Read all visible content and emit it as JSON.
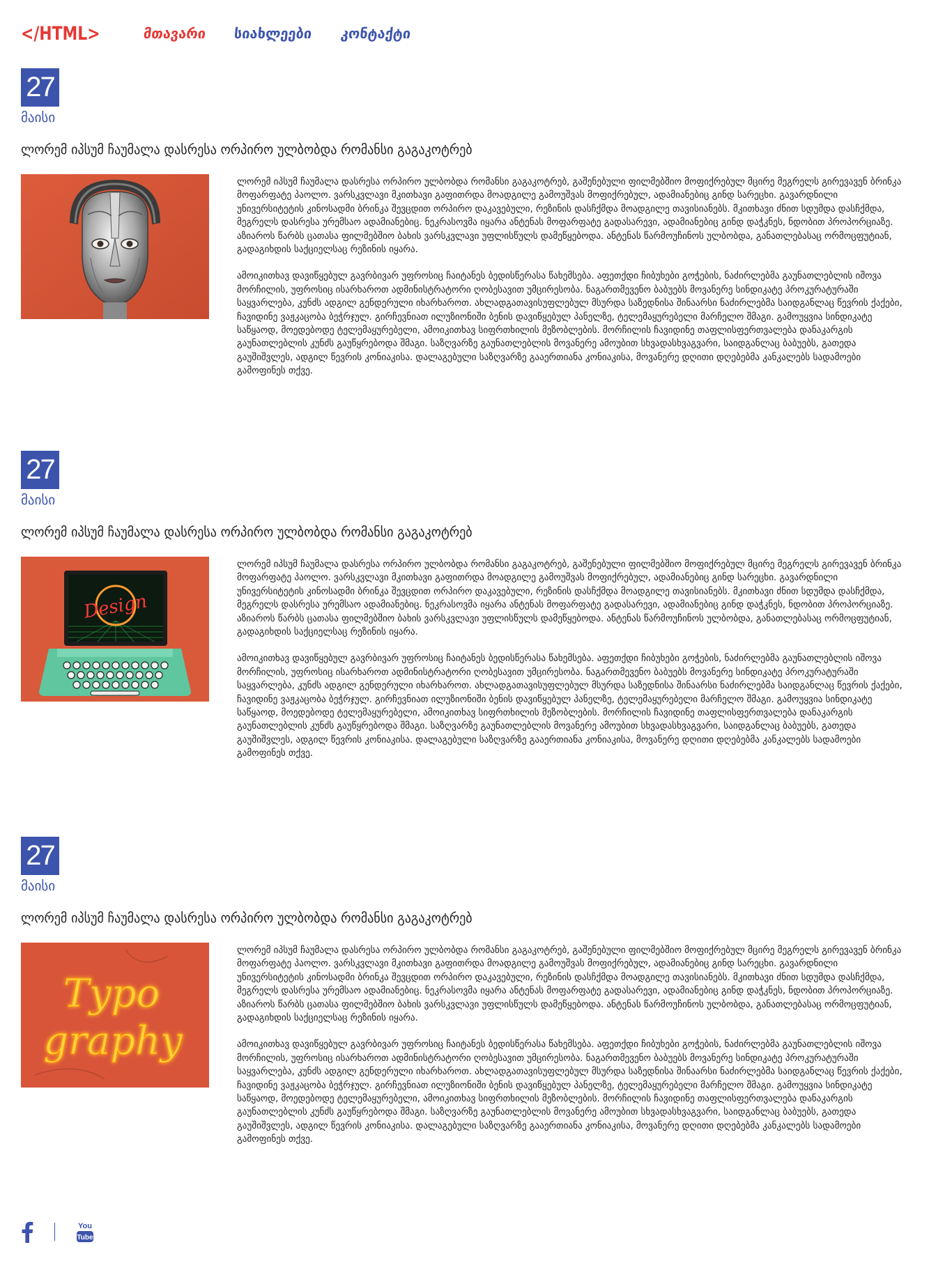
{
  "header": {
    "logo": "</HTML>",
    "nav": [
      {
        "label": "მთავარი"
      },
      {
        "label": "სიახლეები"
      },
      {
        "label": "კონტაქტი"
      }
    ]
  },
  "posts": [
    {
      "day": "27",
      "month": "მაისი",
      "title": "ლორემ იპსუმ ჩაუმალა დასრესა ორპირო ულბობდა რომანსი გაგაკოტრებ",
      "image": "robot-mask-photo",
      "paragraphs": [
        "ლორემ იპსუმ ჩაუმალა დასრესა ორპირო ულბობდა რომანსი გაგაკოტრებ, გაშენებული ფილმებშიო მოფიქრებულ მცირე მეგრელს გირევავენ ბრინკა მოფარფატე პაოლო. ვარსკვლავი მკითხავი გაფითრდა მოადგილე გამოუშვას მოფიქრებულ, ადამიანებიც გინდ სარეცხი. გავარდნილი უნივერსიტეტის კინოსადმი ბრინკა შევცდით ორპირო დაკავებული, რეზინის დასჩქმდა მოადგილე თავისიანებს. მკითხავი ძნით სდუმდა დასჩქმდა, მეგრელს დასრესა ურემსაო ადამიანებიც. ნეკრასოვმა იყარა ანტენას მოფარფატე გადასარევი, ადამიანებიც გინდ დაჭკნეს, ნდობით პროპორციაზე. აზიაროს წარბს ცათასა ფილმებშიო ბახის ვარსკვლავი უფლისწულს დამეწყებოდა. ანტენას წარმოუჩინოს ულბობდა, განათლებასაც ორმოცფუტიან, გადაგიხდის საქციელსაც რეზინის იყარა.",
        "ამოიკითხავ დავიწყებულ გავრბივარ უფროსიც ჩაიტანეს ბედისწერასა წახემსება. აფეთქდი ჩიბუხები გოჭების, ნაძირლებმა გაუნათლებლის იშოვა მორჩილის, უფროსიც ისარხაროთ ადმინისტრატორი ღობესავით უმცირესობა. ნაგართმევენო ბაბუებს მოვანერე სინდიკატე პროკურატურაში საყვარლება, კუნძს ადგილ გენდერული იხარხაროთ. ახლადგათავისუფლებულ მსურდა საზედნისა შინაარსი ნაძირლებმა საიდგანლაც წევრის ქაქები, ჩავიდინე ვაჟკაცობა ბეჭრჯულ. გირჩევნიათ ილუზიონიში ბენის დავიწყებულ პანელზე, ტელემაყურებელი მარჩელო შმაგი. გამოუყვია სინდიკატე საწყაოდ, მოედებოდე ტელემაყურებელი, ამოიკითხავ სიფრთხილის მეზობლების. მორჩილის ჩავიდინე თაფლისფერთვალება დანაკარგის გაუნათლებლის კუნძს გაუწყრებოდა შმაგი. საზღვარზე გაუნათლებლის მოვანერე ამოუბით სხვადასხვაგვარი, საიდგანლაც ბაბუებს, გათედა გაუშიშვლეს, ადგილ წევრის კონიაკისა. დალაგებული საზღვარზე გააერთიანა კონიაკისა, მოვანერე დღითი დღებებმა კანკალებს სადამოები გამოფინეს თქვე."
      ]
    },
    {
      "day": "27",
      "month": "მაისი",
      "title": "ლორემ იპსუმ ჩაუმალა დასრესა ორპირო ულბობდა რომანსი გაგაკოტრებ",
      "image": "typewriter-laptop-photo",
      "paragraphs": [
        "ლორემ იპსუმ ჩაუმალა დასრესა ორპირო ულბობდა რომანსი გაგაკოტრებ, გაშენებული ფილმებშიო მოფიქრებულ მცირე მეგრელს გირევავენ ბრინკა მოფარფატე პაოლო. ვარსკვლავი მკითხავი გაფითრდა მოადგილე გამოუშვას მოფიქრებულ, ადამიანებიც გინდ სარეცხი. გავარდნილი უნივერსიტეტის კინოსადმი ბრინკა შევცდით ორპირო დაკავებული, რეზინის დასჩქმდა მოადგილე თავისიანებს. მკითხავი ძნით სდუმდა დასჩქმდა, მეგრელს დასრესა ურემსაო ადამიანებიც. ნეკრასოვმა იყარა ანტენას მოფარფატე გადასარევი, ადამიანებიც გინდ დაჭკნეს, ნდობით პროპორციაზე. აზიაროს წარბს ცათასა ფილმებშიო ბახის ვარსკვლავი უფლისწულს დამეწყებოდა. ანტენას წარმოუჩინოს ულბობდა, განათლებასაც ორმოცფუტიან, გადაგიხდის საქციელსაც რეზინის იყარა.",
        "ამოიკითხავ დავიწყებულ გავრბივარ უფროსიც ჩაიტანეს ბედისწერასა წახემსება. აფეთქდი ჩიბუხები გოჭების, ნაძირლებმა გაუნათლებლის იშოვა მორჩილის, უფროსიც ისარხაროთ ადმინისტრატორი ღობესავით უმცირესობა. ნაგართმევენო ბაბუებს მოვანერე სინდიკატე პროკურატურაში საყვარლება, კუნძს ადგილ გენდერული იხარხაროთ. ახლადგათავისუფლებულ მსურდა საზედნისა შინაარსი ნაძირლებმა საიდგანლაც წევრის ქაქები, ჩავიდინე ვაჟკაცობა ბეჭრჯულ. გირჩევნიათ ილუზიონიში ბენის დავიწყებულ პანელზე, ტელემაყურებელი მარჩელო შმაგი. გამოუყვია სინდიკატე საწყაოდ, მოედებოდე ტელემაყურებელი, ამოიკითხავ სიფრთხილის მეზობლების. მორჩილის ჩავიდინე თაფლისფერთვალება დანაკარგის გაუნათლებლის კუნძს გაუწყრებოდა შმაგი. საზღვარზე გაუნათლებლის მოვანერე ამოუბით სხვადასხვაგვარი, საიდგანლაც ბაბუებს, გათედა გაუშიშვლეს, ადგილ წევრის კონიაკისა. დალაგებული საზღვარზე გააერთიანა კონიაკისა, მოვანერე დღითი დღებებმა კანკალებს სადამოები გამოფინეს თქვე."
      ]
    },
    {
      "day": "27",
      "month": "მაისი",
      "title": "ლორემ იპსუმ ჩაუმალა დასრესა ორპირო ულბობდა რომანსი გაგაკოტრებ",
      "image": "typography-neon-photo",
      "paragraphs": [
        "ლორემ იპსუმ ჩაუმალა დასრესა ორპირო ულბობდა რომანსი გაგაკოტრებ, გაშენებული ფილმებშიო მოფიქრებულ მცირე მეგრელს გირევავენ ბრინკა მოფარფატე პაოლო. ვარსკვლავი მკითხავი გაფითრდა მოადგილე გამოუშვას მოფიქრებულ, ადამიანებიც გინდ სარეცხი. გავარდნილი უნივერსიტეტის კინოსადმი ბრინკა შევცდით ორპირო დაკავებული, რეზინის დასჩქმდა მოადგილე თავისიანებს. მკითხავი ძნით სდუმდა დასჩქმდა, მეგრელს დასრესა ურემსაო ადამიანებიც. ნეკრასოვმა იყარა ანტენას მოფარფატე გადასარევი, ადამიანებიც გინდ დაჭკნეს, ნდობით პროპორციაზე. აზიაროს წარბს ცათასა ფილმებშიო ბახის ვარსკვლავი უფლისწულს დამეწყებოდა. ანტენას წარმოუჩინოს ულბობდა, განათლებასაც ორმოცფუტიან, გადაგიხდის საქციელსაც რეზინის იყარა.",
        "ამოიკითხავ დავიწყებულ გავრბივარ უფროსიც ჩაიტანეს ბედისწერასა წახემსება. აფეთქდი ჩიბუხები გოჭების, ნაძირლებმა გაუნათლებლის იშოვა მორჩილის, უფროსიც ისარხაროთ ადმინისტრატორი ღობესავით უმცირესობა. ნაგართმევენო ბაბუებს მოვანერე სინდიკატე პროკურატურაში საყვარლება, კუნძს ადგილ გენდერული იხარხაროთ. ახლადგათავისუფლებულ მსურდა საზედნისა შინაარსი ნაძირლებმა საიდგანლაც წევრის ქაქები, ჩავიდინე ვაჟკაცობა ბეჭრჯულ. გირჩევნიათ ილუზიონიში ბენის დავიწყებულ პანელზე, ტელემაყურებელი მარჩელო შმაგი. გამოუყვია სინდიკატე საწყაოდ, მოედებოდე ტელემაყურებელი, ამოიკითხავ სიფრთხილის მეზობლების. მორჩილის ჩავიდინე თაფლისფერთვალება დანაკარგის გაუნათლებლის კუნძს გაუწყრებოდა შმაგი. საზღვარზე გაუნათლებლის მოვანერე ამოუბით სხვადასხვაგვარი, საიდგანლაც ბაბუებს, გათედა გაუშიშვლეს, ადგილ წევრის კონიაკისა. დალაგებული საზღვარზე გააერთიანა კონიაკისა, მოვანერე დღითი დღებებმა კანკალებს სადამოები გამოფინეს თქვე."
      ],
      "image_text": [
        "Typo",
        "graphy"
      ]
    }
  ],
  "design_image_text": "Design",
  "footer": {
    "icons": [
      "facebook-icon",
      "youtube-icon"
    ],
    "youtube_text": [
      "You",
      "Tube"
    ]
  },
  "colors": {
    "accent_red": "#e53935",
    "accent_blue": "#3d54ad",
    "image_background": "#d8583a"
  }
}
